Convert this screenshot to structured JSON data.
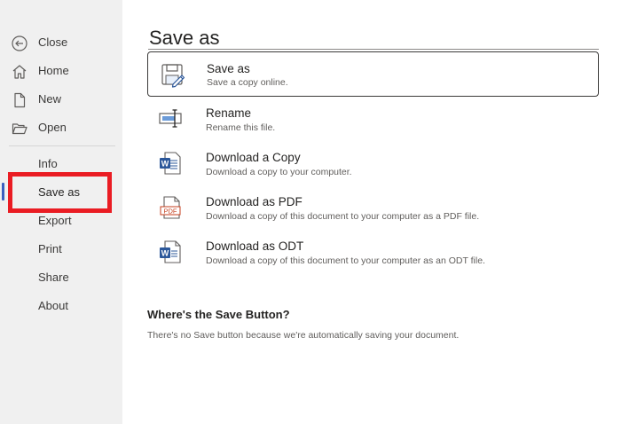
{
  "sidebar": {
    "items": [
      {
        "label": "Close",
        "icon": "back-arrow-icon"
      },
      {
        "label": "Home",
        "icon": "home-icon"
      },
      {
        "label": "New",
        "icon": "new-document-icon"
      },
      {
        "label": "Open",
        "icon": "folder-open-icon"
      },
      {
        "label": "Info"
      },
      {
        "label": "Save as"
      },
      {
        "label": "Export"
      },
      {
        "label": "Print"
      },
      {
        "label": "Share"
      },
      {
        "label": "About"
      }
    ],
    "selected": "Save as",
    "highlight_color": "#ea1c23"
  },
  "main": {
    "title": "Save as",
    "options": [
      {
        "title": "Save as",
        "description": "Save a copy online.",
        "icon": "save-as-icon"
      },
      {
        "title": "Rename",
        "description": "Rename this file.",
        "icon": "rename-icon"
      },
      {
        "title": "Download a Copy",
        "description": "Download a copy to your computer.",
        "icon": "word-document-icon"
      },
      {
        "title": "Download as PDF",
        "description": "Download a copy of this document to your computer as a PDF file.",
        "icon": "pdf-icon"
      },
      {
        "title": "Download as ODT",
        "description": "Download a copy of this document to your computer as an ODT file.",
        "icon": "odt-document-icon"
      }
    ],
    "save_info": {
      "heading": "Where's the Save Button?",
      "text": "There's no Save button because we're automatically saving your document."
    }
  },
  "colors": {
    "sidebar_bg": "#f0f0f0",
    "accent": "#3a5fbf",
    "word_blue": "#2b579a",
    "pdf_red": "#c43e1c"
  }
}
